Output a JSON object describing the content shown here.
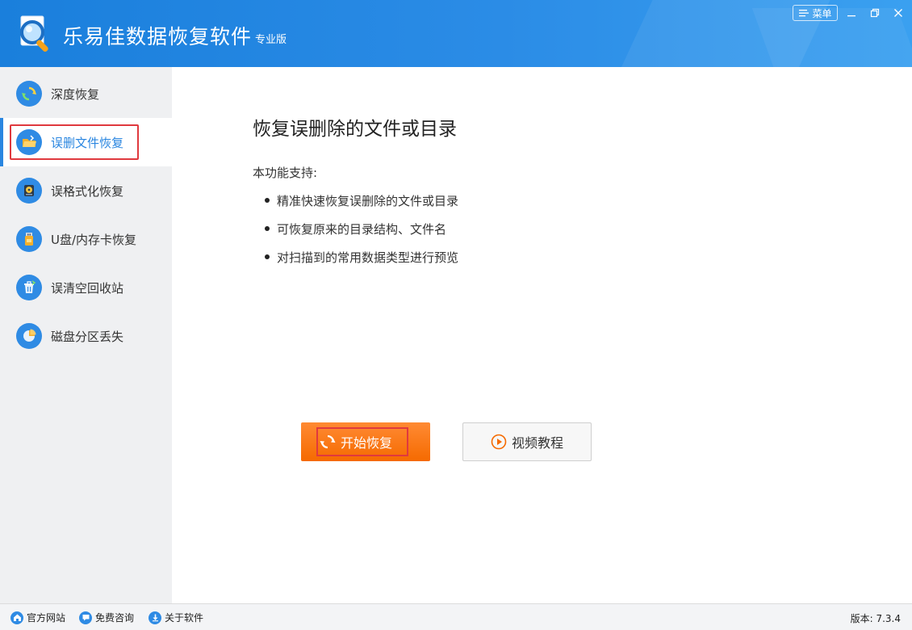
{
  "header": {
    "title": "乐易佳数据恢复软件",
    "edition": "专业版",
    "menu_label": "菜单"
  },
  "sidebar": {
    "items": [
      {
        "label": "深度恢复",
        "icon": "refresh-icon"
      },
      {
        "label": "误删文件恢复",
        "icon": "folder-open-icon",
        "active": true
      },
      {
        "label": "误格式化恢复",
        "icon": "disk-icon"
      },
      {
        "label": "U盘/内存卡恢复",
        "icon": "usb-drive-icon"
      },
      {
        "label": "误清空回收站",
        "icon": "recycle-bin-icon"
      },
      {
        "label": "磁盘分区丢失",
        "icon": "pie-partition-icon"
      }
    ]
  },
  "main": {
    "title": "恢复误删除的文件或目录",
    "support_label": "本功能支持:",
    "features": [
      "精准快速恢复误删除的文件或目录",
      "可恢复原来的目录结构、文件名",
      "对扫描到的常用数据类型进行预览"
    ],
    "start_button": "开始恢复",
    "video_button": "视频教程"
  },
  "statusbar": {
    "links": [
      "官方网站",
      "免费咨询",
      "关于软件"
    ],
    "version": "版本: 7.3.4"
  },
  "colors": {
    "header_blue": "#2b8ce6",
    "accent_blue": "#2a86e0",
    "start_orange": "#f56a00",
    "highlight_red": "#e0393e"
  }
}
